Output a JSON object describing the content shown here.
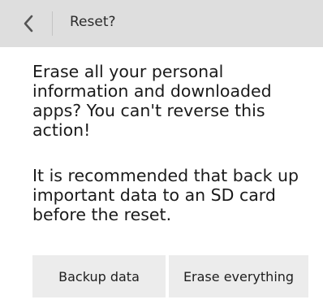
{
  "header": {
    "title": "Reset?",
    "back_icon": "chevron-left-icon"
  },
  "dialog": {
    "message": "Erase all your personal information and downloaded apps? You can't reverse this action!",
    "recommendation": "It is recommended that back up important data to an SD card before the reset."
  },
  "buttons": {
    "backup_label": "Backup data",
    "erase_label": "Erase everything"
  },
  "colors": {
    "titlebar_bg": "#dedede",
    "button_bg": "#ececec",
    "text": "#1a1a1a"
  }
}
